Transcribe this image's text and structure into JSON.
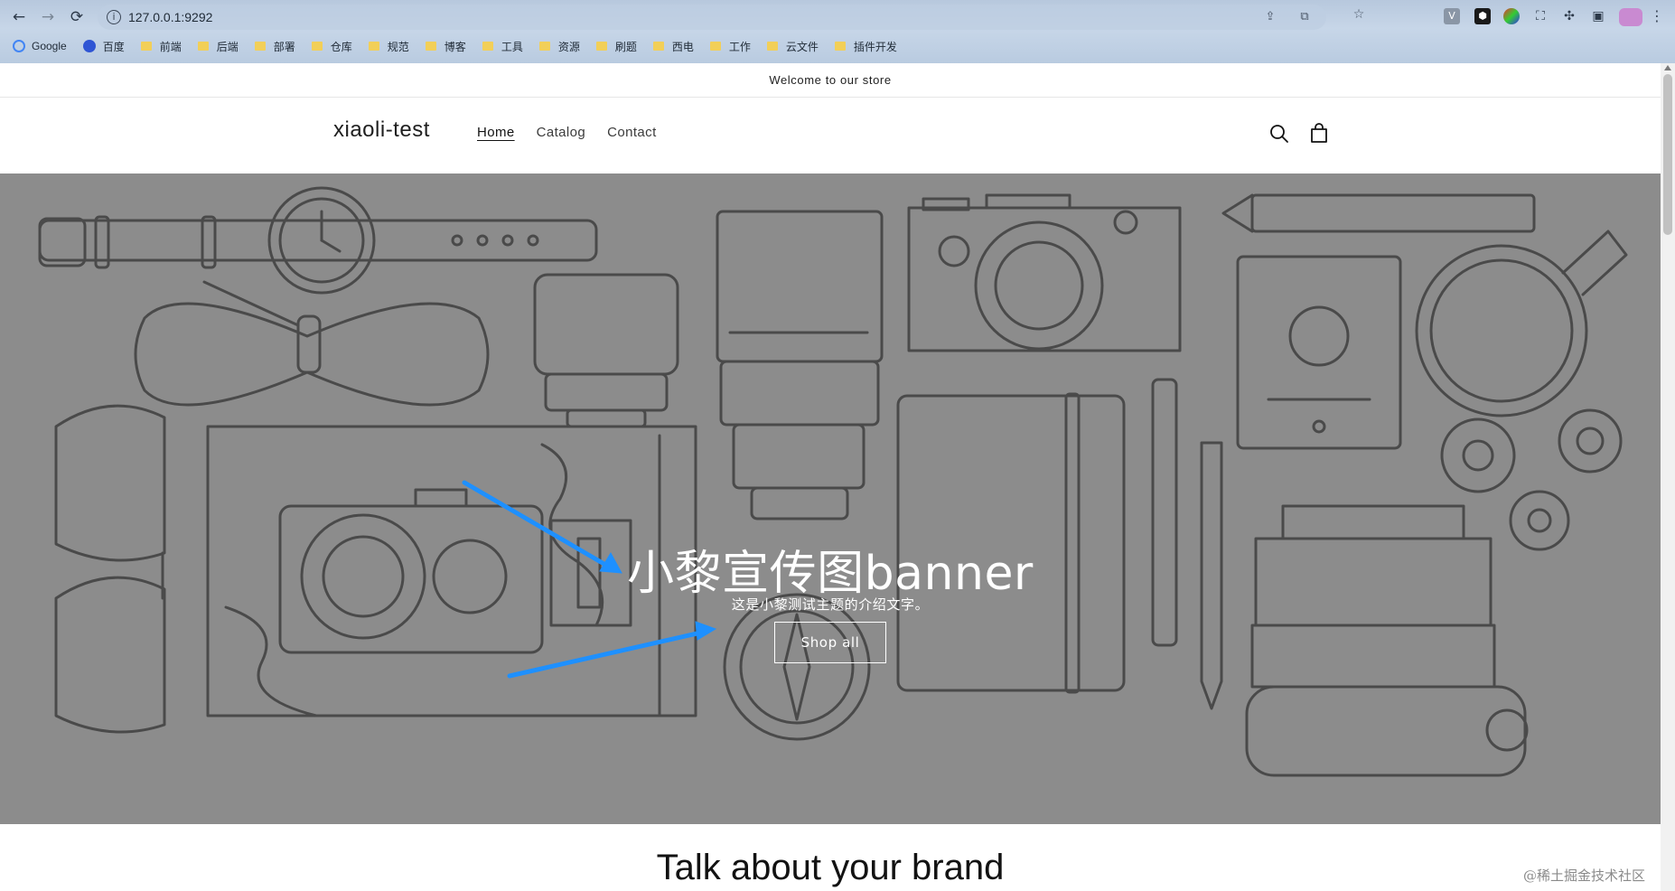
{
  "browser": {
    "url": "127.0.0.1:9292",
    "bookmarks": [
      "Google",
      "百度",
      "前端",
      "后端",
      "部署",
      "仓库",
      "规范",
      "博客",
      "工具",
      "资源",
      "刷题",
      "西电",
      "工作",
      "云文件",
      "插件开发"
    ]
  },
  "store": {
    "announcement": "Welcome to our store",
    "logo": "xiaoli-test",
    "nav": [
      "Home",
      "Catalog",
      "Contact"
    ],
    "active_nav": "Home"
  },
  "banner": {
    "title": "小黎宣传图banner",
    "subtitle": "这是小黎测试主题的介绍文字。",
    "button_label": "Shop all",
    "background_color": "#8c8c8c",
    "annotation_color": "#1e90ff"
  },
  "next_section": {
    "title": "Talk about your brand"
  },
  "watermark": "@稀土掘金技术社区"
}
